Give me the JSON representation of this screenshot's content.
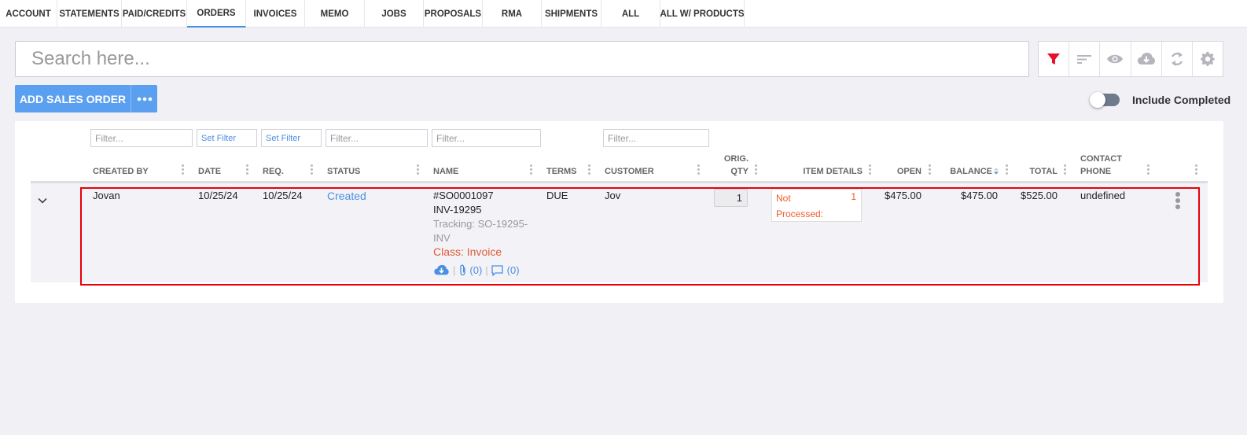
{
  "tabs": [
    {
      "label": "ACCOUNT"
    },
    {
      "label": "STATEMENTS"
    },
    {
      "label": "PAID/CREDITS"
    },
    {
      "label": "ORDERS"
    },
    {
      "label": "INVOICES"
    },
    {
      "label": "MEMO"
    },
    {
      "label": "JOBS"
    },
    {
      "label": "PROPOSALS"
    },
    {
      "label": "RMA"
    },
    {
      "label": "SHIPMENTS"
    },
    {
      "label": "ALL"
    },
    {
      "label": "ALL W/ PRODUCTS"
    }
  ],
  "active_tab": "ORDERS",
  "search": {
    "placeholder": "Search here..."
  },
  "toolbar": {
    "icons": [
      "filter-icon",
      "sort-icon",
      "eye-icon",
      "cloud-download-icon",
      "refresh-icon",
      "gear-icon"
    ],
    "filter_color": "#e8102a",
    "icon_color": "#b5b5bd"
  },
  "actions": {
    "add_label": "ADD SALES ORDER",
    "more_label": "•••",
    "include_completed_label": "Include Completed",
    "include_completed": false
  },
  "filters": [
    {
      "column": "created_by",
      "text": "Filter..."
    },
    {
      "column": "date",
      "text": "Set Filter"
    },
    {
      "column": "req",
      "text": "Set Filter"
    },
    {
      "column": "status",
      "text": "Filter..."
    },
    {
      "column": "name",
      "text": "Filter..."
    },
    {
      "column": "customer",
      "text": "Filter..."
    }
  ],
  "columns": {
    "created_by": "CREATED BY",
    "date": "DATE",
    "req": "REQ.",
    "status": "STATUS",
    "name": "NAME",
    "terms": "TERMS",
    "customer": "CUSTOMER",
    "orig_qty_1": "ORIG.",
    "orig_qty_2": "QTY",
    "item_details": "ITEM DETAILS",
    "open": "OPEN",
    "balance": "BALANCE",
    "total": "TOTAL",
    "contact_1": "CONTACT",
    "contact_2": "PHONE"
  },
  "sort": {
    "column": "balance",
    "icon": "sort-icon"
  },
  "rows": [
    {
      "created_by": "Jovan",
      "date": "10/25/24",
      "req": "10/25/24",
      "status": "Created",
      "name_number": "#SO0001097",
      "name_invoice": "INV-19295",
      "tracking_1": "Tracking: SO-19295-",
      "tracking_2": "INV",
      "class_label": "Class: Invoice",
      "attachments": "(0)",
      "comments": "(0)",
      "link_sep": "|",
      "terms": "DUE",
      "customer": "Jov",
      "orig_qty": "1",
      "item_status_1": "Not",
      "item_status_2": "Processed:",
      "item_count": "1",
      "open": "$475.00",
      "balance": "$475.00",
      "total": "$525.00",
      "contact_phone": "undefined"
    }
  ],
  "colors": {
    "accent": "#4a90e2",
    "primary_button": "#5b9ff0",
    "highlight_border": "#e8000b",
    "warning_text": "#f25a2a"
  }
}
